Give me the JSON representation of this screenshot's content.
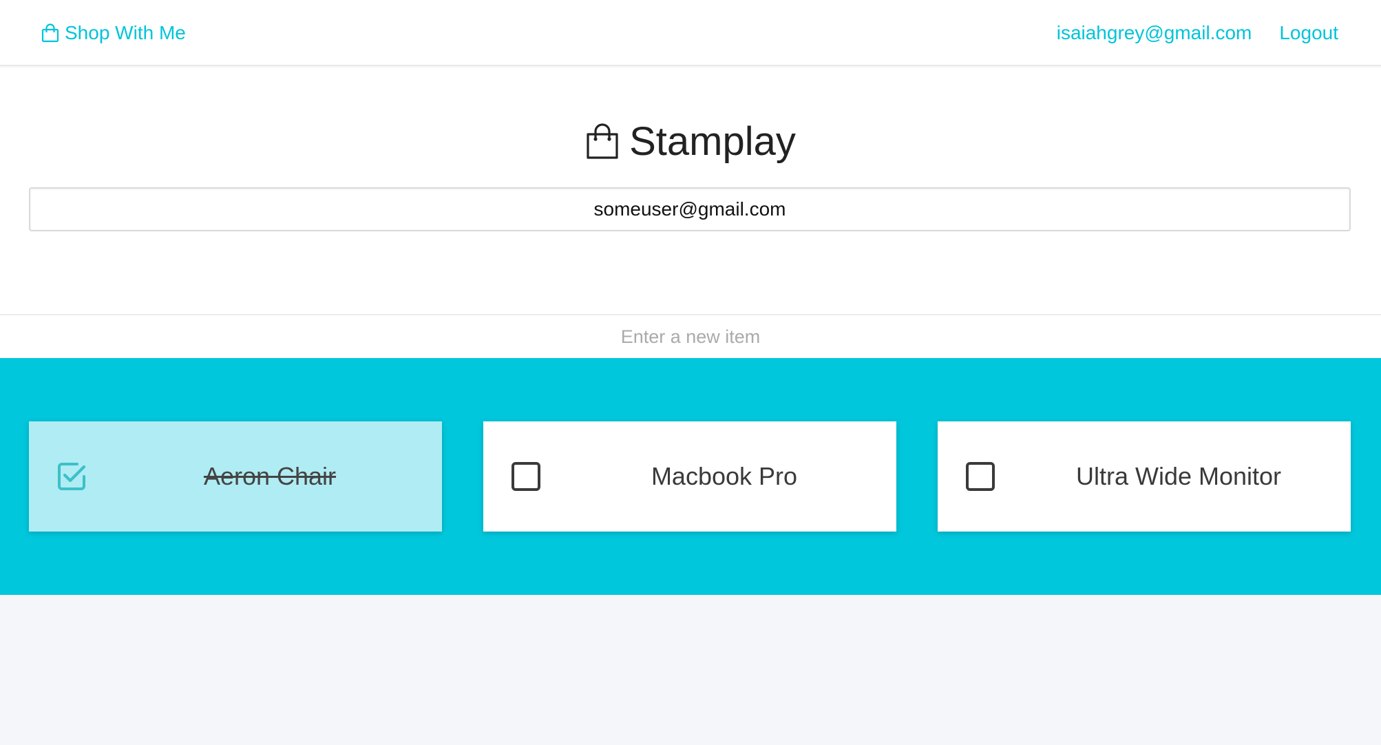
{
  "navbar": {
    "brand_label": "Shop With Me",
    "brand_icon": "shopping-bag-icon",
    "user_email": "isaiahgrey@gmail.com",
    "logout_label": "Logout"
  },
  "header": {
    "title": "Stamplay",
    "title_icon": "shopping-bag-icon",
    "search_value": "someuser@gmail.com"
  },
  "new_item": {
    "placeholder": "Enter a new item",
    "value": ""
  },
  "items": [
    {
      "label": "Aeron Chair",
      "checked": true
    },
    {
      "label": "Macbook Pro",
      "checked": false
    },
    {
      "label": "Ultra Wide Monitor",
      "checked": false
    }
  ],
  "colors": {
    "accent": "#00c4d9",
    "section_bg": "#00c7dc",
    "checked_card_bg": "#b0ecf3",
    "checkbox_checked": "#3cc0c9",
    "checkbox_unchecked": "#3a3a3a"
  }
}
